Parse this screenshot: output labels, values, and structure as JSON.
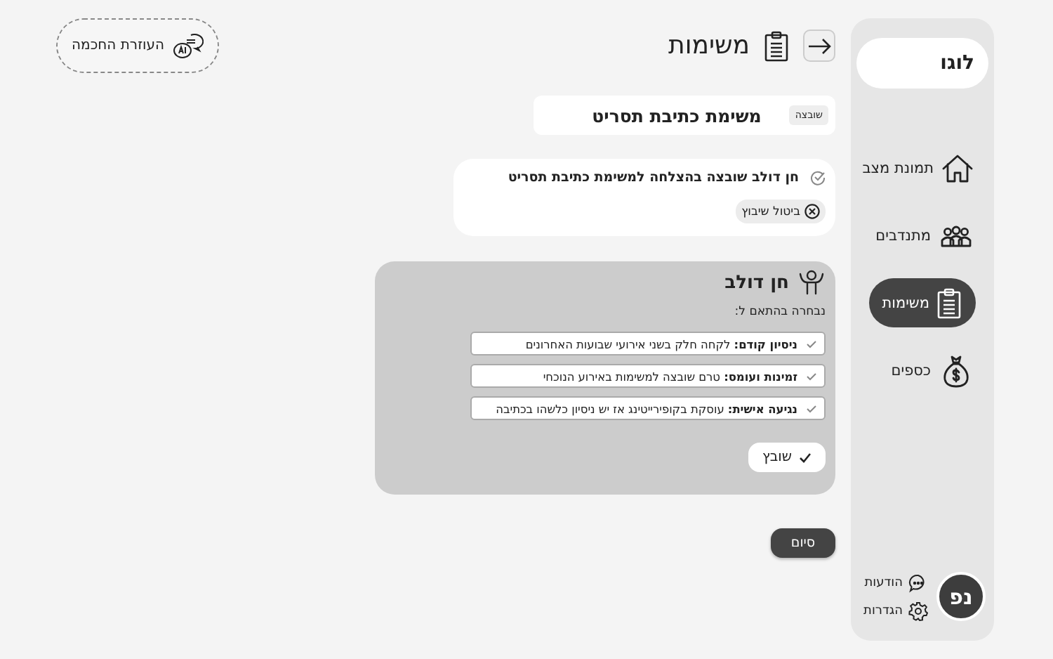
{
  "assistant_button": {
    "label": "העוזרת החכמה"
  },
  "header": {
    "title": "משימות"
  },
  "sidebar": {
    "logo": "לוגו",
    "items": [
      {
        "label": "תמונת מצב",
        "selected": false
      },
      {
        "label": "מתנדבים",
        "selected": false
      },
      {
        "label": "משימות",
        "selected": true
      },
      {
        "label": "כספים",
        "selected": false
      }
    ],
    "user": {
      "initials": "נפ"
    },
    "links": [
      {
        "label": "הודעות"
      },
      {
        "label": "הגדרות"
      }
    ]
  },
  "task": {
    "title": "משימת כתיבת תסריט",
    "status": "שובצה"
  },
  "confirmation": {
    "message": "חן דולב שובצה בהצלחה למשימת כתיבת תסריט",
    "cancel": "ביטול שיבוץ"
  },
  "volunteer": {
    "name": "חן דולב",
    "reasons_title": "נבחרה בהתאם ל:",
    "reasons": [
      {
        "text": "**ניסיון קודם:** לקחה חלק בשני אירועי שבועות האחרונים",
        "checked": true
      },
      {
        "text": "**זמינות ועומס:** טרם שובצה למשימות באירוע הנוכחי",
        "checked": true
      },
      {
        "text": "**נגיעה אישית:** עוסקת בקופירייטינג אז יש ניסיון כלשהו בכתיבה",
        "checked": true
      }
    ],
    "assign_button": "שובץ"
  },
  "finish_button": "סיום"
}
